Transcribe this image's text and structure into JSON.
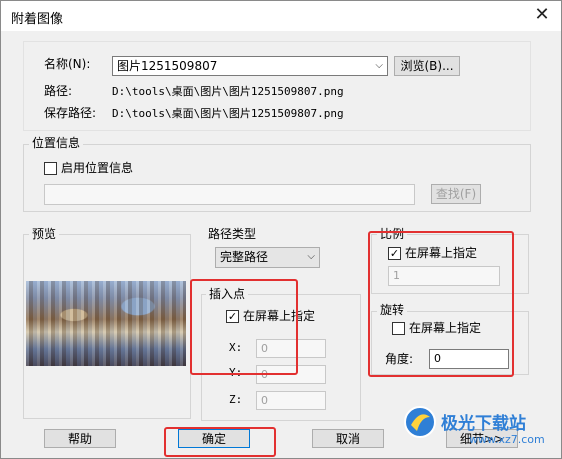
{
  "window": {
    "title": "附着图像",
    "close_glyph": "✕"
  },
  "name_row": {
    "label": "名称(N):",
    "value": "图片1251509807",
    "browse_label": "浏览(B)..."
  },
  "path_row": {
    "label": "路径:",
    "value": "D:\\tools\\桌面\\图片\\图片1251509807.png"
  },
  "save_path_row": {
    "label": "保存路径:",
    "value": "D:\\tools\\桌面\\图片\\图片1251509807.png"
  },
  "location": {
    "group_title": "位置信息",
    "enable_label": "启用位置信息",
    "enable_checked": false,
    "field_value": "",
    "find_label": "查找(F)"
  },
  "preview": {
    "group_title": "预览",
    "image_icon": "preview-image"
  },
  "path_type": {
    "label": "路径类型",
    "selected": "完整路径"
  },
  "insertion_point": {
    "group_title": "插入点",
    "on_screen_label": "在屏幕上指定",
    "on_screen_checked": true,
    "x_label": "X:",
    "x_value": "0",
    "y_label": "Y:",
    "y_value": "0",
    "z_label": "Z:",
    "z_value": "0"
  },
  "scale": {
    "group_title": "比例",
    "on_screen_label": "在屏幕上指定",
    "on_screen_checked": true,
    "value": "1"
  },
  "rotation": {
    "group_title": "旋转",
    "on_screen_label": "在屏幕上指定",
    "on_screen_checked": false,
    "angle_label": "角度:",
    "angle_value": "0"
  },
  "buttons": {
    "help": "帮助",
    "ok": "确定",
    "cancel": "取消",
    "details": "细节>>"
  },
  "watermark": {
    "brand": "极光下载站",
    "url": "www.xz7.com"
  },
  "colors": {
    "highlight_red": "#e23030",
    "dialog_bg": "#f0f0f0"
  }
}
